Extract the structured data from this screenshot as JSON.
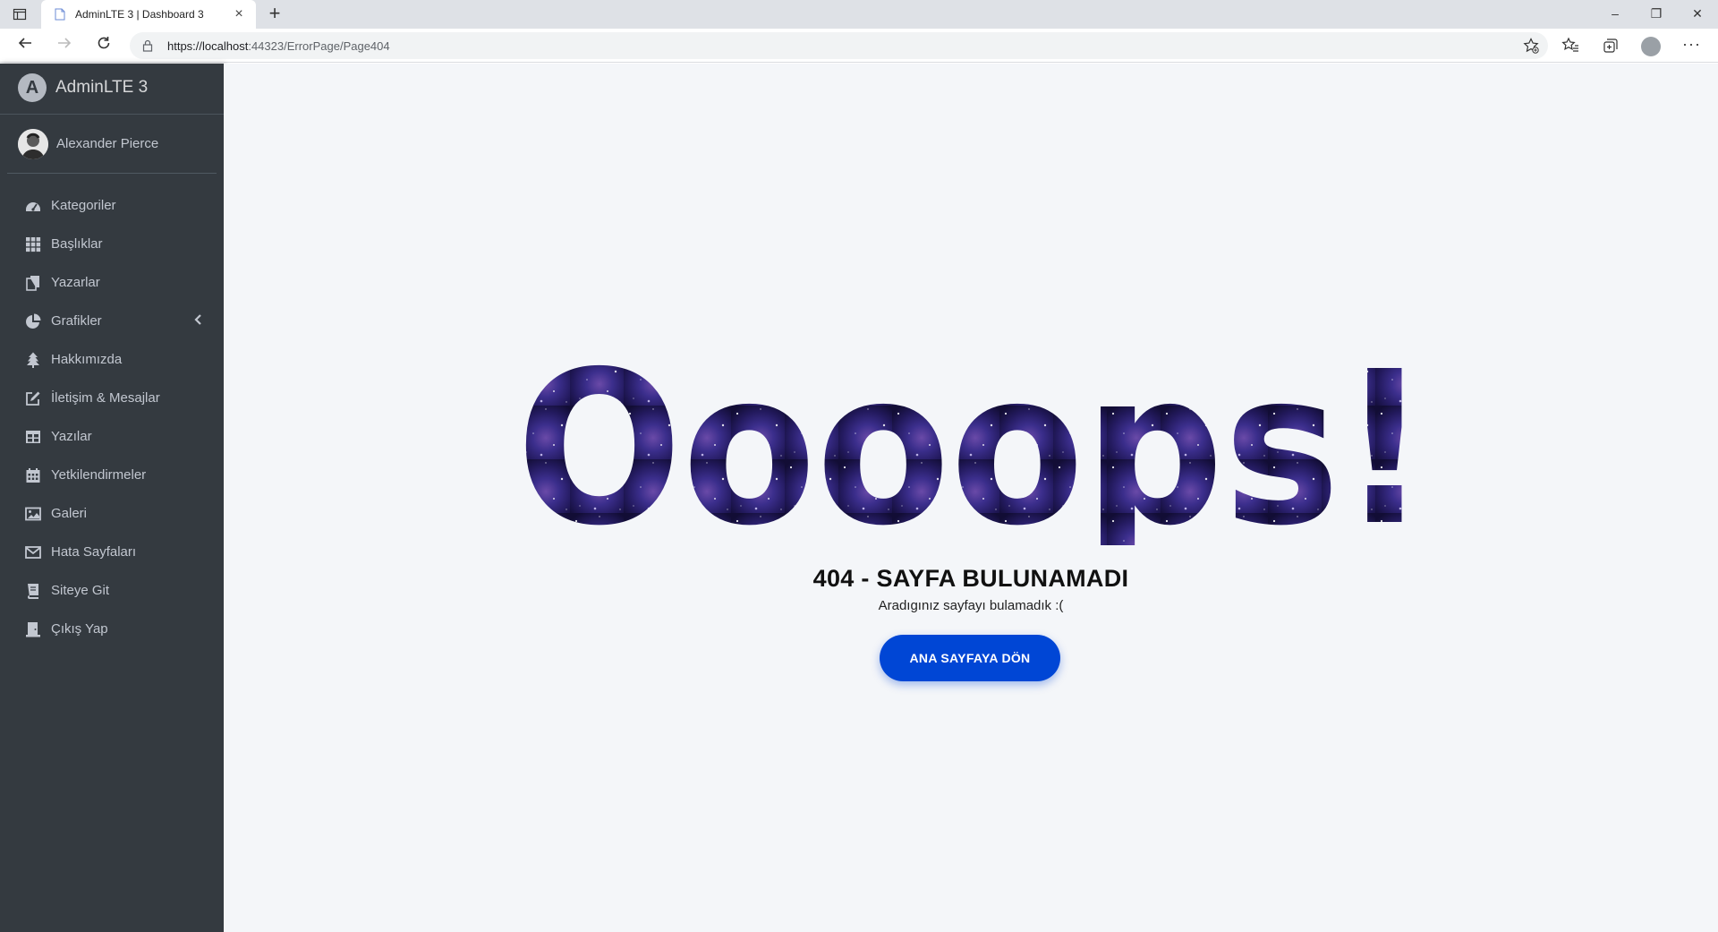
{
  "browser": {
    "tab_title": "AdminLTE 3 | Dashboard 3",
    "url_host": "https://localhost",
    "url_path": ":44323/ErrorPage/Page404",
    "new_tab_label": "+",
    "tab_close_label": "×",
    "minimize_label": "–",
    "restore_label": "❐",
    "close_label": "✕",
    "more_label": "···"
  },
  "sidebar": {
    "brand": "AdminLTE 3",
    "brand_logo_letter": "A",
    "user_name": "Alexander Pierce",
    "items": [
      {
        "label": "Kategoriler",
        "icon": "tachometer-icon"
      },
      {
        "label": "Başlıklar",
        "icon": "grid-icon"
      },
      {
        "label": "Yazarlar",
        "icon": "copy-icon"
      },
      {
        "label": "Grafikler",
        "icon": "pie-chart-icon",
        "has_submenu": true
      },
      {
        "label": "Hakkımızda",
        "icon": "tree-icon"
      },
      {
        "label": "İletişim & Mesajlar",
        "icon": "edit-icon"
      },
      {
        "label": "Yazılar",
        "icon": "table-icon"
      },
      {
        "label": "Yetkilendirmeler",
        "icon": "calendar-icon"
      },
      {
        "label": "Galeri",
        "icon": "image-icon"
      },
      {
        "label": "Hata Sayfaları",
        "icon": "envelope-icon"
      },
      {
        "label": "Siteye Git",
        "icon": "book-icon"
      },
      {
        "label": "Çıkış Yap",
        "icon": "user-exit-icon"
      }
    ]
  },
  "error_page": {
    "oops_text": "Oooops!",
    "heading": "404 - SAYFA BULUNAMADI",
    "subtext": "Aradıgınız sayfayı bulamadık :(",
    "button_label": "ANA SAYFAYA DÖN"
  },
  "colors": {
    "sidebar_bg": "#343a40",
    "content_bg": "#f4f6f9",
    "button_bg": "#0046d5",
    "galaxy_dark": "#1a1445",
    "galaxy_light": "#4a3aa0"
  }
}
